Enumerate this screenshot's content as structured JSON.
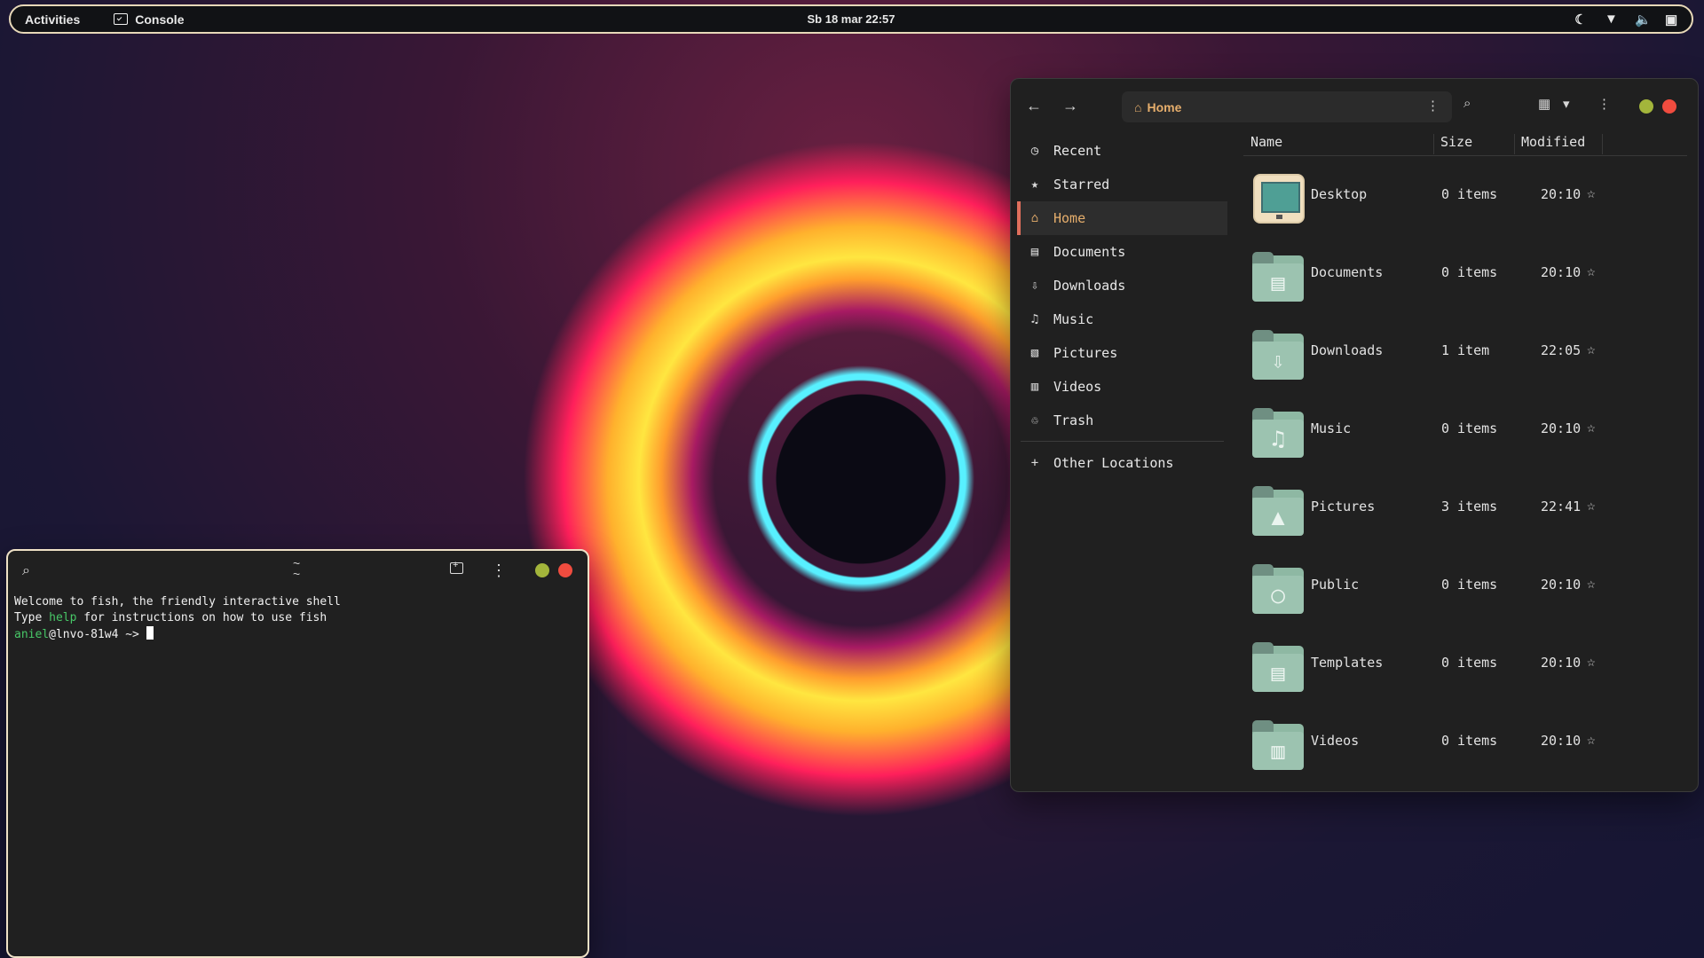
{
  "topbar": {
    "activities": "Activities",
    "app_name": "Console",
    "datetime": "Sb 18 mar  22:57",
    "tray_icons": [
      "night-light-icon",
      "wifi-icon",
      "volume-icon",
      "battery-icon"
    ]
  },
  "terminal": {
    "title": "~",
    "subtitle": "~",
    "lines": {
      "welcome": "Welcome to fish, the friendly interactive shell",
      "type_prefix": "Type ",
      "help_word": "help",
      "type_suffix": " for instructions on how to use fish",
      "prompt_user": "aniel",
      "prompt_host": "@lnvo-81w4 ",
      "prompt_path": "~>"
    },
    "colors": {
      "min": "#a3b53b",
      "close": "#f04c3f"
    }
  },
  "files": {
    "path": "Home",
    "sidebar": [
      {
        "label": "Recent",
        "icon": "clock-icon"
      },
      {
        "label": "Starred",
        "icon": "star-icon"
      },
      {
        "label": "Home",
        "icon": "home-icon"
      },
      {
        "label": "Documents",
        "icon": "document-icon"
      },
      {
        "label": "Downloads",
        "icon": "download-icon"
      },
      {
        "label": "Music",
        "icon": "music-icon"
      },
      {
        "label": "Pictures",
        "icon": "picture-icon"
      },
      {
        "label": "Videos",
        "icon": "video-icon"
      },
      {
        "label": "Trash",
        "icon": "trash-icon"
      },
      {
        "label": "Other Locations",
        "icon": "plus-icon"
      }
    ],
    "columns": {
      "name": "Name",
      "size": "Size",
      "modified": "Modified"
    },
    "rows": [
      {
        "name": "Desktop",
        "size": "0 items",
        "modified": "20:10",
        "icon": "desktop-icon"
      },
      {
        "name": "Documents",
        "size": "0 items",
        "modified": "20:10",
        "icon": "document-icon"
      },
      {
        "name": "Downloads",
        "size": "1 item",
        "modified": "22:05",
        "icon": "download-icon"
      },
      {
        "name": "Music",
        "size": "0 items",
        "modified": "20:10",
        "icon": "music-icon"
      },
      {
        "name": "Pictures",
        "size": "3 items",
        "modified": "22:41",
        "icon": "picture-icon"
      },
      {
        "name": "Public",
        "size": "0 items",
        "modified": "20:10",
        "icon": "user-icon"
      },
      {
        "name": "Templates",
        "size": "0 items",
        "modified": "20:10",
        "icon": "template-icon"
      },
      {
        "name": "Videos",
        "size": "0 items",
        "modified": "20:10",
        "icon": "video-icon"
      }
    ],
    "colors": {
      "accent": "#e6ae6c",
      "active_border": "#df6e5c",
      "folder": "#9cc3b0"
    }
  }
}
